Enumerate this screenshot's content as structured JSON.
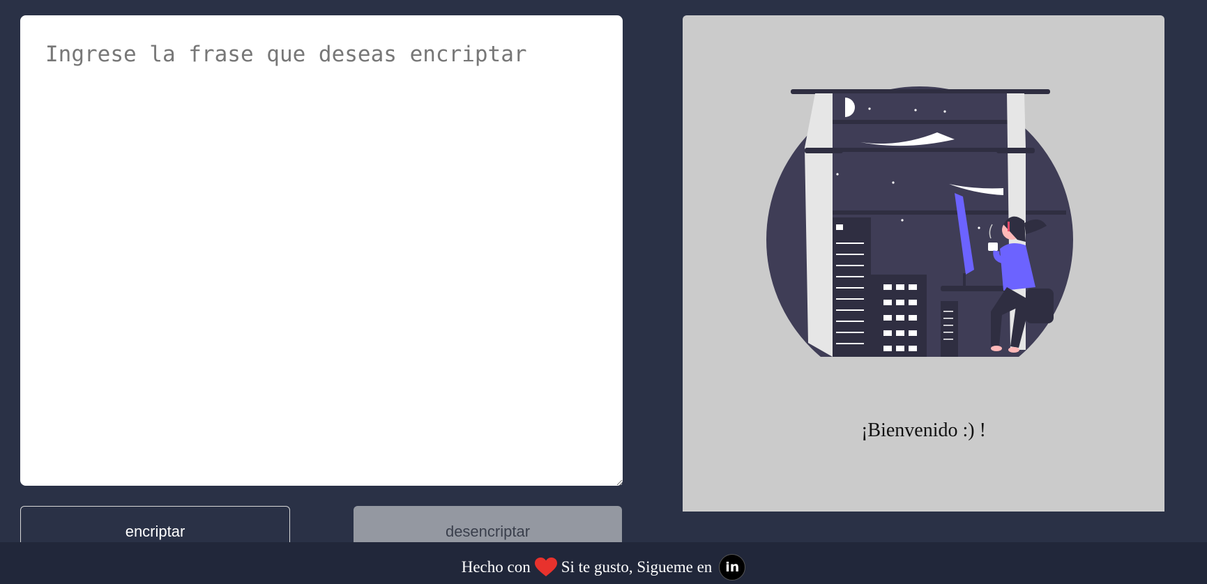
{
  "input": {
    "placeholder": "Ingrese la frase que deseas encriptar",
    "value": ""
  },
  "buttons": {
    "encrypt_label": "encriptar",
    "decrypt_label": "desencriptar"
  },
  "panel": {
    "illustration_icon": "woman-at-window-night-city-illustration",
    "welcome_text": "¡Bienvenido :) !"
  },
  "footer": {
    "made_with": "Hecho con",
    "heart_icon": "heart-icon",
    "follow_text": "Si te gusto, Sigueme en",
    "linkedin_icon": "linkedin-icon",
    "linkedin_glyph": "in"
  },
  "colors": {
    "background": "#2a3146",
    "footer": "#21273a",
    "panel": "#cbcbcb",
    "accent_purple": "#6c63ff",
    "heart": "#e8322d"
  }
}
